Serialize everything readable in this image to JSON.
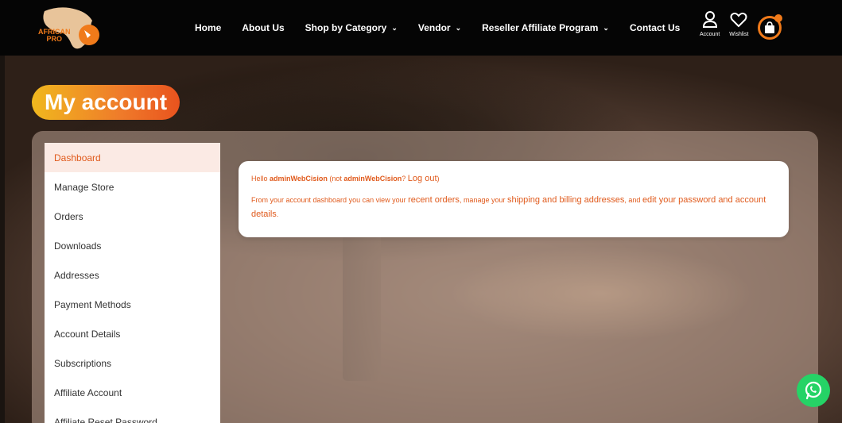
{
  "header": {
    "logo": {
      "line1": "AFRICAN",
      "line2": "PRO"
    },
    "nav": [
      {
        "label": "Home",
        "dropdown": false
      },
      {
        "label": "About Us",
        "dropdown": false
      },
      {
        "label": "Shop by Category",
        "dropdown": true
      },
      {
        "label": "Vendor",
        "dropdown": true
      },
      {
        "label": "Reseller Affiliate Program",
        "dropdown": true
      },
      {
        "label": "Contact Us",
        "dropdown": false
      }
    ],
    "account_label": "Account",
    "wishlist_label": "Wishlist"
  },
  "page": {
    "title": "My account"
  },
  "sidebar": {
    "items": [
      {
        "label": "Dashboard",
        "active": true
      },
      {
        "label": "Manage Store"
      },
      {
        "label": "Orders"
      },
      {
        "label": "Downloads"
      },
      {
        "label": "Addresses"
      },
      {
        "label": "Payment Methods"
      },
      {
        "label": "Account Details"
      },
      {
        "label": "Subscriptions"
      },
      {
        "label": "Affiliate Account"
      },
      {
        "label": "Affiliate Reset Password"
      }
    ]
  },
  "dashboard": {
    "hello": "Hello",
    "username": "adminWebCision",
    "not_prefix": "(not",
    "not_username": "adminWebCision",
    "logout_prefix": "?",
    "logout": "Log out",
    "logout_suffix": ")",
    "desc_1": "From your account dashboard you can view your",
    "recent_orders": "recent orders",
    "desc_2": ", manage your",
    "addresses": "shipping and billing addresses",
    "desc_3": ", and",
    "account_details": "edit your password and account details",
    "desc_4": "."
  },
  "colors": {
    "accent": "#e05a1c",
    "header_bg": "#050505",
    "whatsapp": "#25d366"
  }
}
